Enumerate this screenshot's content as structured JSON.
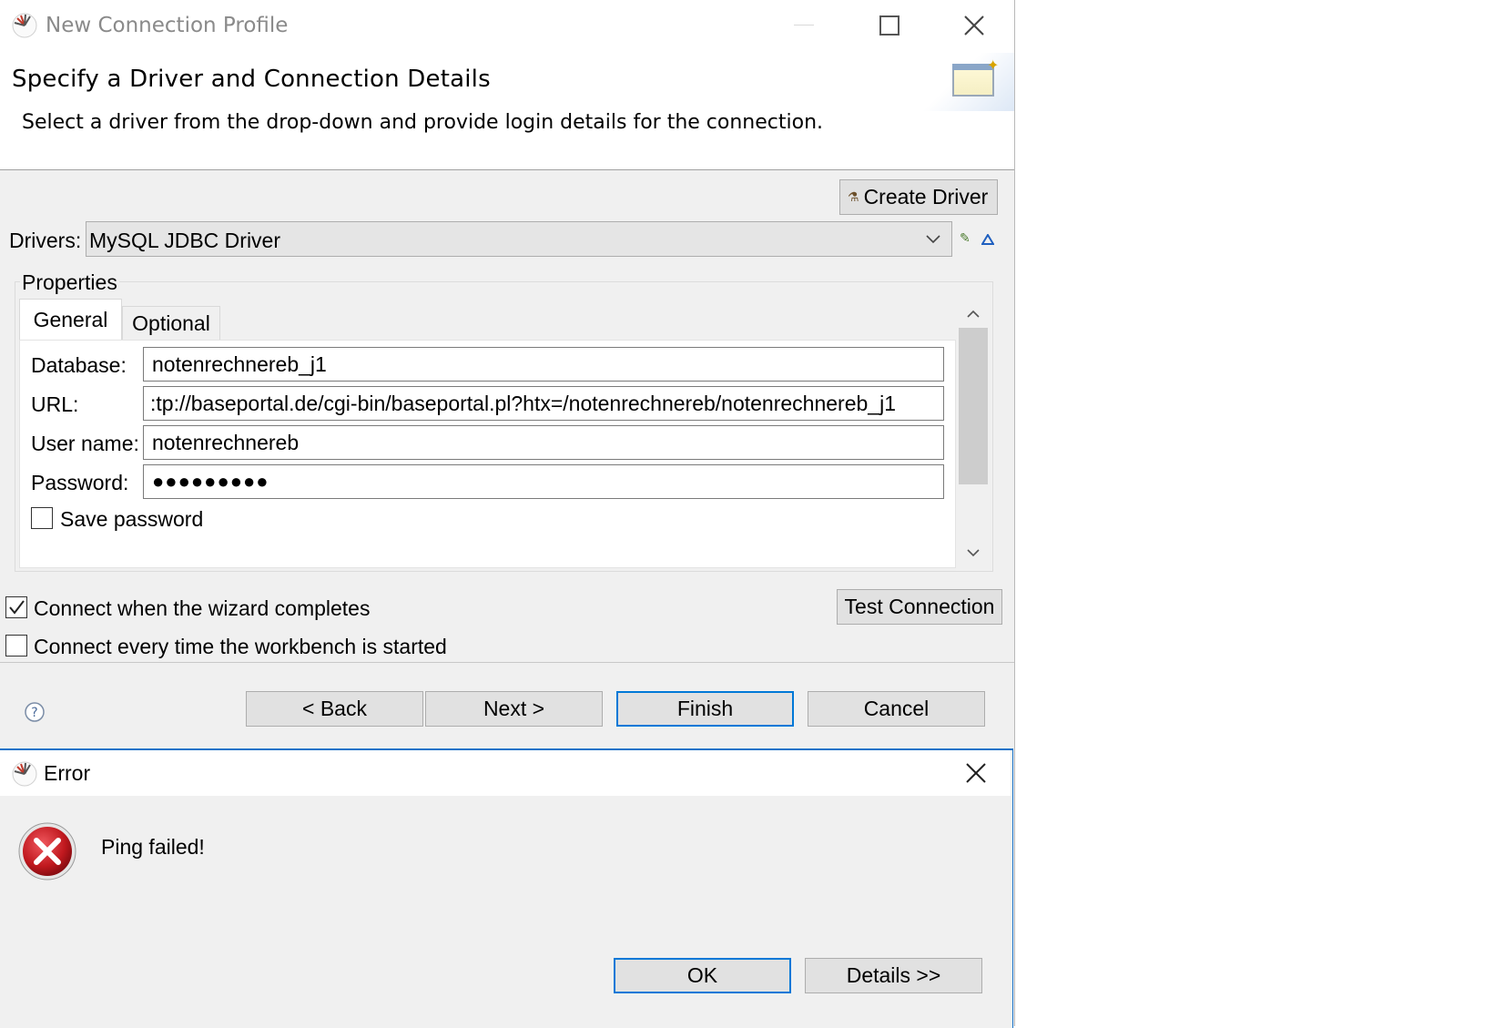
{
  "window": {
    "title": "New Connection Profile",
    "minimize_glyph": "—",
    "maximize_glyph": "☐",
    "close_glyph": "✕"
  },
  "header": {
    "title": "Specify a Driver and Connection Details",
    "subtitle": "Select a driver from the drop-down and provide login details for the connection."
  },
  "toolbar": {
    "create_driver_label": "Create Driver"
  },
  "drivers": {
    "label": "Drivers:",
    "selected": "MySQL JDBC Driver"
  },
  "properties": {
    "group_label": "Properties",
    "tabs": [
      {
        "label": "General",
        "active": true
      },
      {
        "label": "Optional",
        "active": false
      }
    ],
    "fields": {
      "database_label": "Database:",
      "database_value": "notenrechnereb_j1",
      "url_label": "URL:",
      "url_value": ":tp://baseportal.de/cgi-bin/baseportal.pl?htx=/notenrechnereb/notenrechnereb_j1",
      "username_label": "User name:",
      "username_value": "notenrechnereb",
      "password_label": "Password:",
      "password_value": "●●●●●●●●●"
    },
    "save_password_label": "Save password",
    "save_password_checked": false
  },
  "options": {
    "connect_on_complete_label": "Connect when the wizard completes",
    "connect_on_complete_checked": true,
    "connect_every_start_label": "Connect every time the workbench is started",
    "connect_every_start_checked": false,
    "test_connection_label": "Test Connection"
  },
  "footer": {
    "back_label": "< Back",
    "next_label": "Next >",
    "finish_label": "Finish",
    "cancel_label": "Cancel"
  },
  "error_dialog": {
    "title": "Error",
    "message": "Ping failed!",
    "ok_label": "OK",
    "details_label": "Details >>"
  },
  "colors": {
    "accent": "#0078d7",
    "error_red": "#c0181e",
    "dialog_bg": "#f0f0f0"
  }
}
